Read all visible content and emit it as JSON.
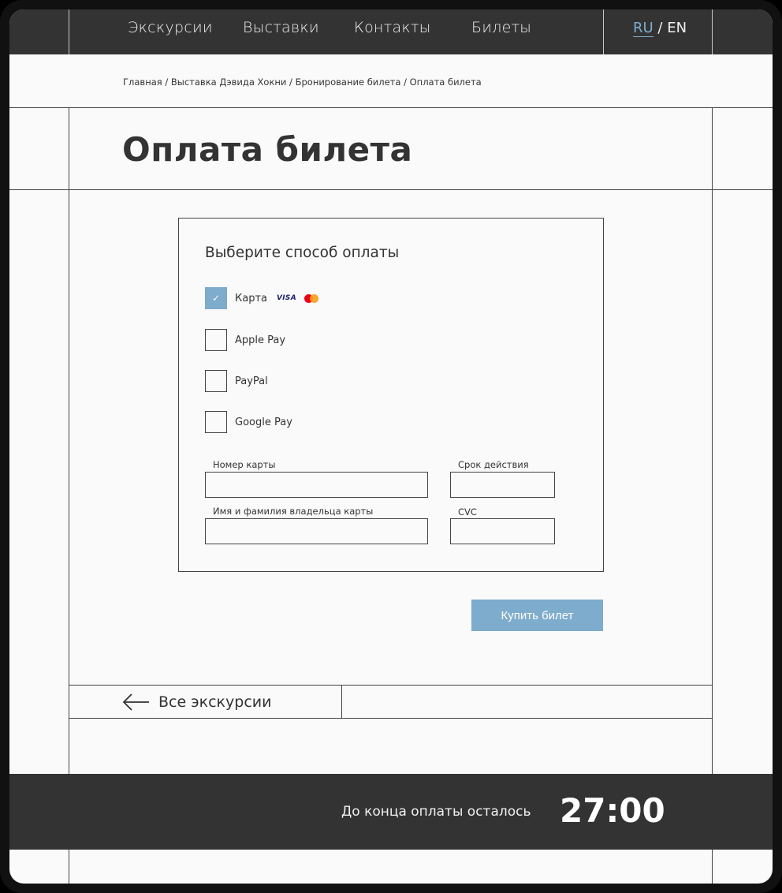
{
  "nav": {
    "items": [
      {
        "label": "Экскурсии"
      },
      {
        "label": "Выставки"
      },
      {
        "label": "Контакты"
      },
      {
        "label": "Билеты"
      }
    ],
    "lang_ru": "RU",
    "lang_sep": " / ",
    "lang_en": "EN"
  },
  "breadcrumb": {
    "items": [
      "Главная",
      "Выставка Дэвида Хокни",
      "Бронирование билета",
      "Оплата билета"
    ],
    "separator": " / "
  },
  "page": {
    "title": "Оплата билета"
  },
  "payment": {
    "heading": "Выберите способ оплаты",
    "options": [
      {
        "label": "Карта",
        "checked": true,
        "check_mark": "✓"
      },
      {
        "label": "Apple Pay",
        "checked": false
      },
      {
        "label": "PayPal",
        "checked": false
      },
      {
        "label": "Google Pay",
        "checked": false
      }
    ],
    "card_brands": {
      "visa": "VISA",
      "mastercard_icon": "mastercard-icon"
    },
    "fields": {
      "card_number": {
        "label": "Номер карты",
        "value": ""
      },
      "expiry": {
        "label": "Срок действия",
        "value": ""
      },
      "holder": {
        "label": "Имя и фамилия владельца карты",
        "value": ""
      },
      "cvc": {
        "label": "CVC",
        "value": ""
      }
    }
  },
  "buy_button": {
    "label": "Купить билет"
  },
  "back_link": {
    "label": "Все экскурсии",
    "icon": "arrow-left-icon"
  },
  "timer": {
    "label": "До конца оплаты осталось",
    "value": "27:00"
  },
  "colors": {
    "dark": "#333333",
    "accent": "#7eaccc",
    "background": "#fafafa"
  }
}
